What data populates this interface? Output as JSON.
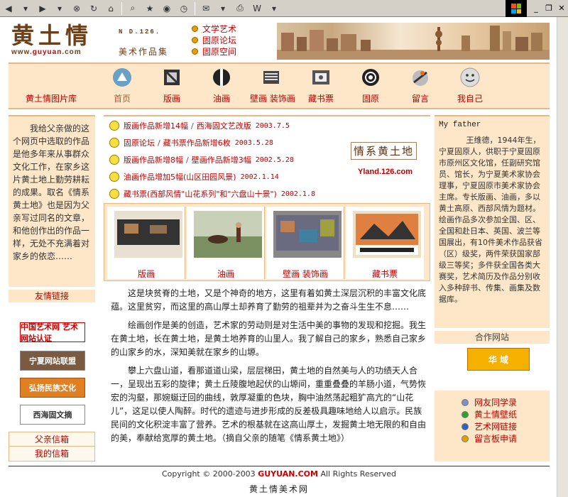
{
  "browser": {
    "buttons": [
      "back-icon",
      "forward-icon",
      "stop-icon",
      "refresh-icon",
      "home-icon",
      "search-icon",
      "favorites-icon",
      "media-icon",
      "history-icon",
      "mail-icon",
      "print-icon",
      "edit-icon"
    ]
  },
  "header": {
    "logo_cn": "黄土情",
    "logo_url_prefix": "www.",
    "logo_url_brand": "guyuan",
    "logo_url_suffix": ".com",
    "issue": "N  D.126.",
    "subtitle": "美术作品集",
    "top_links": [
      "文学艺术",
      "固原论坛",
      "固原空间"
    ]
  },
  "nav": {
    "gallery_label": "黄土情图片库",
    "items": [
      {
        "label": "首页",
        "icon": "home-icon"
      },
      {
        "label": "版画",
        "icon": "print-art-icon"
      },
      {
        "label": "油画",
        "icon": "oil-painting-icon"
      },
      {
        "label": "壁画 装饰画",
        "icon": "mural-icon"
      },
      {
        "label": "藏书票",
        "icon": "bookplate-icon"
      },
      {
        "label": "固原",
        "icon": "guyuan-icon"
      },
      {
        "label": "留言",
        "icon": "message-icon"
      },
      {
        "label": "我自己",
        "icon": "smiley-icon"
      }
    ]
  },
  "left": {
    "intro": "我给父亲做的这个网页中选取的作品是他多年来从事群众文化工作，在家乡这片黄土地上勤劳耕耘的成果。取名《情系黄土地》也是因为父亲写过同名的文章，和他创作出的作品一样，无处不充满着对家乡的依恋……",
    "friends_title": "友情链接",
    "friend_links": [
      "中国艺术网 艺术网站认证",
      "宁夏网站联盟",
      "弘扬民族文化",
      "西海固文摘"
    ],
    "parent_links": [
      "父亲信箱",
      "我的信箱"
    ]
  },
  "news": [
    {
      "a": "版画作品新增14幅",
      "b": "西海固文艺改版",
      "date": "2003.7.5"
    },
    {
      "a": "固原论坛",
      "b": "藏书票作品新增6枚",
      "date": "2003.5.28"
    },
    {
      "a": "版画作品新增8幅",
      "b": "壁画作品新增3幅",
      "date": "2002.5.28"
    },
    {
      "a": "油画作品增加5幅(山区田园风景)",
      "b": "",
      "date": "2002.1.14"
    },
    {
      "a": "藏书票(西部风情\"山花系列\"和\"六盘山十景\")",
      "b": "",
      "date": "2002.1.8"
    }
  ],
  "promo": {
    "title": "情系黄土地",
    "url": "Yland.126.com"
  },
  "gallery": [
    {
      "label": "版画"
    },
    {
      "label": "油画"
    },
    {
      "label": "壁画 装饰画"
    },
    {
      "label": "藏书票"
    }
  ],
  "article": [
    "这是块贫脊的土地，又是个神奇的地方，这里有着如黄土深层沉积的丰富文化底蕴。这里贫穷，而这里的高山厚土却养育了勤劳的祖辈并为之奋斗生生不息……",
    "绘画创作是美的创造，艺术家的劳动则是对生活中美的事物的发现和挖掘。我生在黄土地，长在黄土地，是黄土地养育的山里人。我了解自己的家乡，熟悉自己家乡的山家乡的水，深知美就在家乡的山塬。",
    "攀上六盘山道，看那道道山梁，层层梯田，黄土地的自然美与人的功绩天人合一，呈现出五彩的旋律；黄土丘陵腹地起伏的山塬间，重重叠叠的羊肠小道，气势恢宏的沟壑，那婉蜒迂回的曲线，敦厚凝重的色块，胸中油然荡起粗犷高亢的“山花儿”，这足以使人陶醉。时代的遗迹与进步形成的反差极具趣味地给人以启示。民族民间的文化积淀丰富了营养。艺术的根基就在这高山厚土，发掘黄土地无限的和自由的美，奉献给宽厚的黄土地。（摘自父亲的随笔《情系黄土地》）"
  ],
  "right": {
    "father_title": "My father",
    "father_text": "王维德，1944年生，宁夏固原人，供职于宁夏固原市原州区文化馆，任副研究馆员、馆长，为宁夏美术家协会理事，宁夏固原市美术家协会主席。专长版画、油画，多以黄土高原、西部风情为题材。绘画作品多次参加全国、区、全国和赴日本、英国、波兰等国展出，有10件美术作品获省（区）级奖，两件荣获国家部级三等奖；多件获全国各类大赛奖，艺术简历及作品分别收入多种辞书、传集、画集及数据库。",
    "partner_title": "合作网站",
    "partner_logo": "华 域",
    "links": [
      {
        "label": "网友同学录",
        "color": "#8090c0"
      },
      {
        "label": "黄土情壁纸",
        "color": "#30a030"
      },
      {
        "label": "艺术网链接",
        "color": "#3060c0"
      },
      {
        "label": "留言板申请",
        "color": "#e0a000"
      }
    ]
  },
  "footer": {
    "copyright_pre": "Copyright © 2000-2003 ",
    "copyright_brand": "GUYUAN.COM",
    "copyright_post": " All Rights Reserved",
    "site_name": "黄土情美术网"
  }
}
